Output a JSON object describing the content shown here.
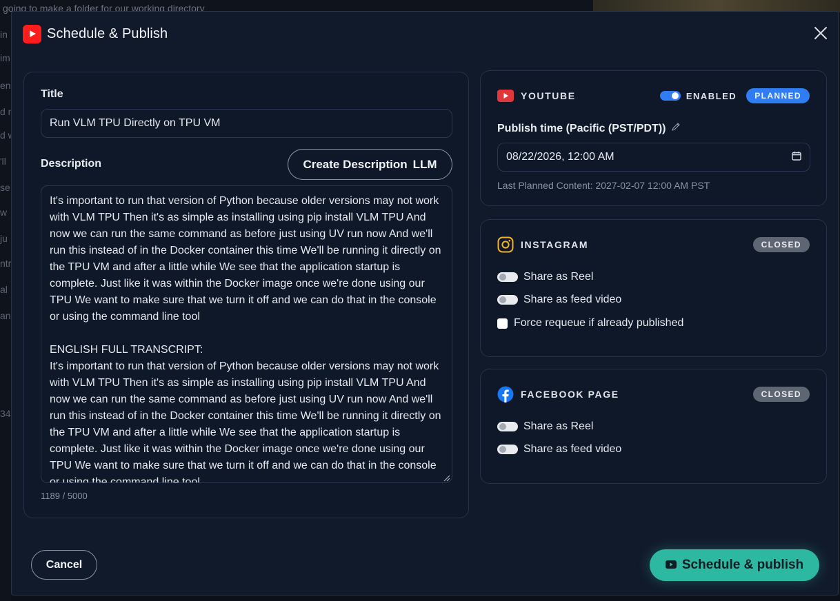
{
  "background": {
    "top_text": "going to make a folder for our working directory",
    "left_fragments": [
      "in",
      "im",
      "en",
      "d n",
      "d w",
      "'ll",
      "se",
      "w",
      "ju",
      "ntr",
      "al",
      "ank",
      "34"
    ]
  },
  "modal": {
    "title": "Schedule & Publish",
    "close_icon": "close-icon",
    "header_icon": "youtube-icon"
  },
  "form": {
    "title_label": "Title",
    "title_value": "Run VLM TPU Directly on TPU VM",
    "description_label": "Description",
    "create_description_label": "Create Description",
    "create_description_suffix": "LLM",
    "description_value": "It's important to run that version of Python because older versions may not work with VLM TPU Then it's as simple as installing using pip install VLM TPU And now we can run the same command as before just using UV run now And we'll run this instead of in the Docker container this time We'll be running it directly on the TPU VM and after a little while We see that the application startup is complete. Just like it was within the Docker image once we're done using our TPU We want to make sure that we turn it off and we can do that in the console or using the command line tool\n\nENGLISH FULL TRANSCRIPT:\nIt's important to run that version of Python because older versions may not work with VLM TPU Then it's as simple as installing using pip install VLM TPU And now we can run the same command as before just using UV run now And we'll run this instead of in the Docker container this time We'll be running it directly on the TPU VM and after a little while We see that the application startup is complete. Just like it was within the Docker image once we're done using our TPU We want to make sure that we turn it off and we can do that in the console or using the command line tool",
    "char_count": "1189 / 5000"
  },
  "youtube": {
    "name": "YOUTUBE",
    "enabled_label": "ENABLED",
    "enabled": true,
    "status": "PLANNED",
    "publish_label": "Publish time (Pacific (PST/PDT))",
    "publish_value": "08/22/2026, 12:00  AM",
    "last_planned": "Last Planned Content: 2027-02-07 12:00 AM PST"
  },
  "instagram": {
    "name": "INSTAGRAM",
    "status": "CLOSED",
    "share_reel_label": "Share as Reel",
    "share_feed_label": "Share as feed video",
    "force_requeue_label": "Force requeue if already published"
  },
  "facebook": {
    "name": "FACEBOOK PAGE",
    "status": "CLOSED",
    "share_reel_label": "Share as Reel",
    "share_feed_label": "Share as feed video"
  },
  "footer": {
    "cancel_label": "Cancel",
    "publish_label": "Schedule & publish"
  },
  "colors": {
    "modal_bg": "#111a2b",
    "card_bg": "#0f1828",
    "youtube_red": "#ff1c1c",
    "accent_blue": "#2f7cf5",
    "publish_teal": "#2db8a2",
    "closed_gray": "#5f6673"
  }
}
